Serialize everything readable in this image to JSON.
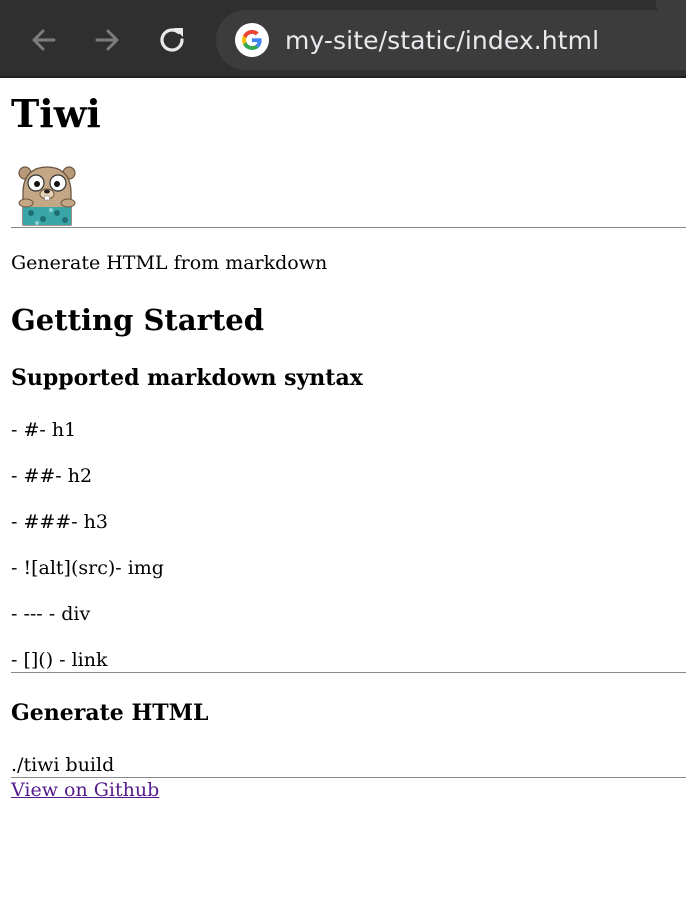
{
  "browser": {
    "url": "my-site/static/index.html",
    "icons": {
      "back": "arrow-left-icon",
      "forward": "arrow-right-icon",
      "reload": "reload-icon",
      "site": "google-g-icon"
    },
    "colors": {
      "toolbar_bg": "#2f2f2f",
      "omnibox_bg": "#3c3c3c",
      "url_text": "#e8eaed"
    }
  },
  "page": {
    "title": "Tiwi",
    "image_alt": "gopher-mascot",
    "description": "Generate HTML from markdown",
    "getting_started": "Getting Started",
    "syntax_heading": "Supported markdown syntax",
    "syntax_items": [
      "- #- h1",
      "- ##- h2",
      "- ###- h3",
      "- ![alt](src)- img",
      "- --- - div",
      "- []() - link"
    ],
    "generate_heading": "Generate HTML",
    "command": "./tiwi build",
    "github_link": "View on Github",
    "colors": {
      "link_visited": "#551a8b",
      "rule": "#8a8a8a"
    }
  }
}
